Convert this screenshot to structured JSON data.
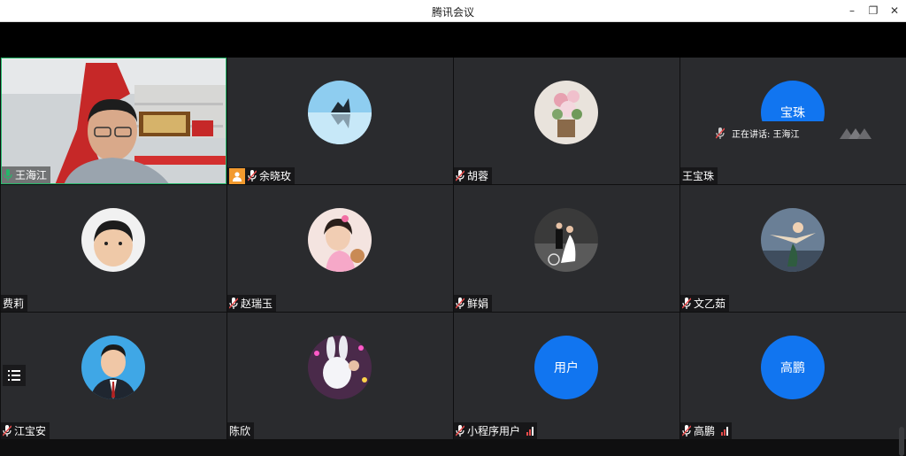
{
  "window": {
    "title": "腾讯会议",
    "min": "–",
    "max": "❐",
    "close": "✕"
  },
  "speaking": {
    "label": "正在讲话: 王海江"
  },
  "participants": [
    {
      "name": "王海江",
      "mic": "on",
      "host": false,
      "signal": false,
      "video": true,
      "avatar_text": ""
    },
    {
      "name": "余晓玫",
      "mic": "off",
      "host": true,
      "signal": false,
      "video": false,
      "avatar_text": ""
    },
    {
      "name": "胡蓉",
      "mic": "off",
      "host": false,
      "signal": false,
      "video": false,
      "avatar_text": ""
    },
    {
      "name": "王宝珠",
      "mic": "none",
      "host": false,
      "signal": false,
      "video": false,
      "avatar_text": "宝珠"
    },
    {
      "name": "费莉",
      "mic": "none",
      "host": false,
      "signal": false,
      "video": false,
      "avatar_text": ""
    },
    {
      "name": "赵瑞玉",
      "mic": "off",
      "host": false,
      "signal": false,
      "video": false,
      "avatar_text": ""
    },
    {
      "name": "鲜娟",
      "mic": "off",
      "host": false,
      "signal": false,
      "video": false,
      "avatar_text": ""
    },
    {
      "name": "文乙茹",
      "mic": "off",
      "host": false,
      "signal": false,
      "video": false,
      "avatar_text": ""
    },
    {
      "name": "江宝安",
      "mic": "off",
      "host": false,
      "signal": false,
      "video": false,
      "avatar_text": ""
    },
    {
      "name": "陈欣",
      "mic": "none",
      "host": false,
      "signal": false,
      "video": false,
      "avatar_text": ""
    },
    {
      "name": "小程序用户",
      "mic": "off",
      "host": false,
      "signal": true,
      "video": false,
      "avatar_text": "用户"
    },
    {
      "name": "高鹏",
      "mic": "off",
      "host": false,
      "signal": true,
      "video": false,
      "avatar_text": "高鹏"
    }
  ],
  "colors": {
    "accent_blue": "#1175f0",
    "active_border": "#25b76a",
    "host_badge": "#f29a2e",
    "mic_on": "#25b76a",
    "mic_off": "#e54b4b"
  }
}
